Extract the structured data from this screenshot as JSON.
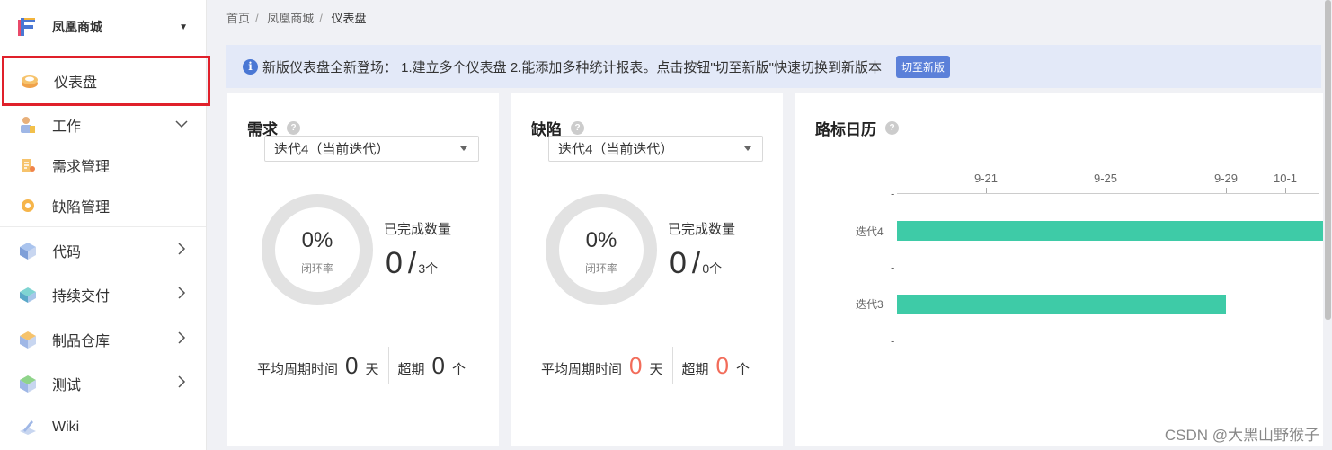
{
  "app": {
    "project_name": "凤凰商城"
  },
  "colors": {
    "accent": "#5b80d9",
    "bar": "#3ecba7",
    "highlight": "#e0202a",
    "overdue": "#f26c5a"
  },
  "sidebar": {
    "items": [
      {
        "label": "仪表盘",
        "icon": "dashboard-icon",
        "active": true
      },
      {
        "label": "工作",
        "icon": "work-icon",
        "expanded": true
      },
      {
        "label": "需求管理",
        "icon": "requirement-icon"
      },
      {
        "label": "缺陷管理",
        "icon": "bug-icon"
      },
      {
        "label": "代码",
        "icon": "code-icon"
      },
      {
        "label": "持续交付",
        "icon": "delivery-icon"
      },
      {
        "label": "制品仓库",
        "icon": "artifact-icon"
      },
      {
        "label": "测试",
        "icon": "test-icon"
      },
      {
        "label": "Wiki",
        "icon": "wiki-icon"
      }
    ]
  },
  "breadcrumb": [
    "首页",
    "凤凰商城",
    "仪表盘"
  ],
  "notice": {
    "text": "新版仪表盘全新登场： 1.建立多个仪表盘 2.能添加多种统计报表。点击按钮\"切至新版\"快速切换到新版本",
    "button": "切至新版"
  },
  "cards": {
    "requirement": {
      "title": "需求",
      "iteration": "迭代4（当前迭代）",
      "rate": "0%",
      "rate_label": "闭环率",
      "done_label": "已完成数量",
      "done": "0",
      "slash": "/",
      "total": "3个",
      "avg_label": "平均周期时间",
      "avg_value": "0",
      "avg_unit": "天",
      "overdue_label": "超期",
      "overdue_value": "0",
      "overdue_unit": "个"
    },
    "defect": {
      "title": "缺陷",
      "iteration": "迭代4（当前迭代）",
      "rate": "0%",
      "rate_label": "闭环率",
      "done_label": "已完成数量",
      "done": "0",
      "slash": "/",
      "total": "0个",
      "avg_label": "平均周期时间",
      "avg_value": "0",
      "avg_unit": "天",
      "overdue_label": "超期",
      "overdue_value": "0",
      "overdue_unit": "个"
    }
  },
  "roadmap": {
    "title": "路标日历",
    "ticks": [
      "9-21",
      "9-25",
      "9-29",
      "10-1"
    ],
    "axis_dash": "-",
    "rows": [
      {
        "label": "迭代4",
        "start": "9-17",
        "end": "10-3+"
      },
      {
        "label": "迭代3",
        "start": "9-17",
        "end": "9-29"
      }
    ],
    "row_dash": "-"
  },
  "watermark": "CSDN @大黑山野猴子"
}
